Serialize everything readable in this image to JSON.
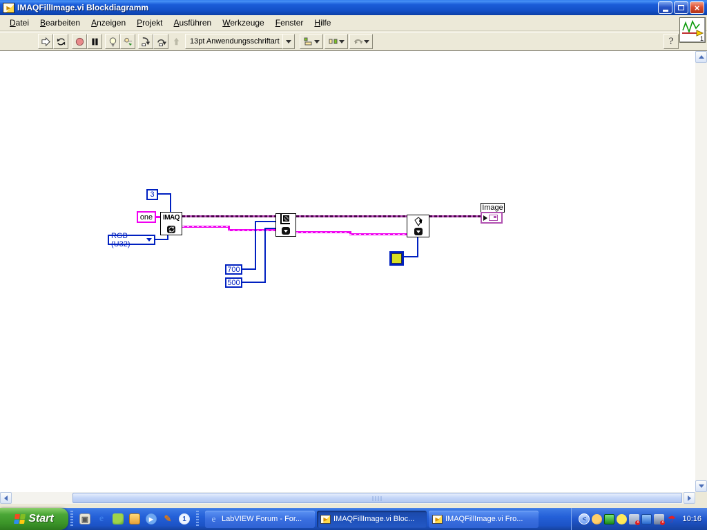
{
  "window": {
    "title": "IMAQFillImage.vi Blockdiagramm"
  },
  "menu": {
    "items": [
      {
        "label": "Datei"
      },
      {
        "label": "Bearbeiten"
      },
      {
        "label": "Anzeigen"
      },
      {
        "label": "Projekt"
      },
      {
        "label": "Ausführen"
      },
      {
        "label": "Werkzeuge"
      },
      {
        "label": "Fenster"
      },
      {
        "label": "Hilfe"
      }
    ]
  },
  "toolbar": {
    "font_selector": "13pt Anwendungsschriftart",
    "help_label": "?",
    "instance_badge": "1"
  },
  "diagram": {
    "constants": {
      "channels": "3",
      "name": "one",
      "image_type": "RGB (U32)",
      "width": "700",
      "height": "500"
    },
    "create_node_label": "IMAQ",
    "image_indicator_label": "Image",
    "colors": {
      "wire_blue": "#0020C0",
      "wire_magenta": "#F000F0",
      "wire_purple": "#4B004B",
      "colorbox_fill": "#D7DF23"
    }
  },
  "taskbar": {
    "start_label": "Start",
    "tasks": [
      {
        "label": "LabVIEW Forum - For..."
      },
      {
        "label": "IMAQFillImage.vi Bloc..."
      },
      {
        "label": "IMAQFillImage.vi Fro..."
      }
    ],
    "clock": "10:16"
  }
}
